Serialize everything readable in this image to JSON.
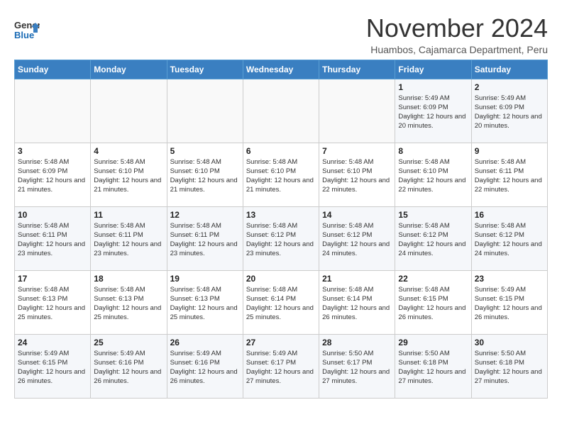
{
  "logo": {
    "line1": "General",
    "line2": "Blue"
  },
  "title": "November 2024",
  "subtitle": "Huambos, Cajamarca Department, Peru",
  "days_of_week": [
    "Sunday",
    "Monday",
    "Tuesday",
    "Wednesday",
    "Thursday",
    "Friday",
    "Saturday"
  ],
  "weeks": [
    [
      {
        "day": "",
        "info": ""
      },
      {
        "day": "",
        "info": ""
      },
      {
        "day": "",
        "info": ""
      },
      {
        "day": "",
        "info": ""
      },
      {
        "day": "",
        "info": ""
      },
      {
        "day": "1",
        "info": "Sunrise: 5:49 AM\nSunset: 6:09 PM\nDaylight: 12 hours and 20 minutes."
      },
      {
        "day": "2",
        "info": "Sunrise: 5:49 AM\nSunset: 6:09 PM\nDaylight: 12 hours and 20 minutes."
      }
    ],
    [
      {
        "day": "3",
        "info": "Sunrise: 5:48 AM\nSunset: 6:09 PM\nDaylight: 12 hours and 21 minutes."
      },
      {
        "day": "4",
        "info": "Sunrise: 5:48 AM\nSunset: 6:10 PM\nDaylight: 12 hours and 21 minutes."
      },
      {
        "day": "5",
        "info": "Sunrise: 5:48 AM\nSunset: 6:10 PM\nDaylight: 12 hours and 21 minutes."
      },
      {
        "day": "6",
        "info": "Sunrise: 5:48 AM\nSunset: 6:10 PM\nDaylight: 12 hours and 21 minutes."
      },
      {
        "day": "7",
        "info": "Sunrise: 5:48 AM\nSunset: 6:10 PM\nDaylight: 12 hours and 22 minutes."
      },
      {
        "day": "8",
        "info": "Sunrise: 5:48 AM\nSunset: 6:10 PM\nDaylight: 12 hours and 22 minutes."
      },
      {
        "day": "9",
        "info": "Sunrise: 5:48 AM\nSunset: 6:11 PM\nDaylight: 12 hours and 22 minutes."
      }
    ],
    [
      {
        "day": "10",
        "info": "Sunrise: 5:48 AM\nSunset: 6:11 PM\nDaylight: 12 hours and 23 minutes."
      },
      {
        "day": "11",
        "info": "Sunrise: 5:48 AM\nSunset: 6:11 PM\nDaylight: 12 hours and 23 minutes."
      },
      {
        "day": "12",
        "info": "Sunrise: 5:48 AM\nSunset: 6:11 PM\nDaylight: 12 hours and 23 minutes."
      },
      {
        "day": "13",
        "info": "Sunrise: 5:48 AM\nSunset: 6:12 PM\nDaylight: 12 hours and 23 minutes."
      },
      {
        "day": "14",
        "info": "Sunrise: 5:48 AM\nSunset: 6:12 PM\nDaylight: 12 hours and 24 minutes."
      },
      {
        "day": "15",
        "info": "Sunrise: 5:48 AM\nSunset: 6:12 PM\nDaylight: 12 hours and 24 minutes."
      },
      {
        "day": "16",
        "info": "Sunrise: 5:48 AM\nSunset: 6:12 PM\nDaylight: 12 hours and 24 minutes."
      }
    ],
    [
      {
        "day": "17",
        "info": "Sunrise: 5:48 AM\nSunset: 6:13 PM\nDaylight: 12 hours and 25 minutes."
      },
      {
        "day": "18",
        "info": "Sunrise: 5:48 AM\nSunset: 6:13 PM\nDaylight: 12 hours and 25 minutes."
      },
      {
        "day": "19",
        "info": "Sunrise: 5:48 AM\nSunset: 6:13 PM\nDaylight: 12 hours and 25 minutes."
      },
      {
        "day": "20",
        "info": "Sunrise: 5:48 AM\nSunset: 6:14 PM\nDaylight: 12 hours and 25 minutes."
      },
      {
        "day": "21",
        "info": "Sunrise: 5:48 AM\nSunset: 6:14 PM\nDaylight: 12 hours and 26 minutes."
      },
      {
        "day": "22",
        "info": "Sunrise: 5:48 AM\nSunset: 6:15 PM\nDaylight: 12 hours and 26 minutes."
      },
      {
        "day": "23",
        "info": "Sunrise: 5:49 AM\nSunset: 6:15 PM\nDaylight: 12 hours and 26 minutes."
      }
    ],
    [
      {
        "day": "24",
        "info": "Sunrise: 5:49 AM\nSunset: 6:15 PM\nDaylight: 12 hours and 26 minutes."
      },
      {
        "day": "25",
        "info": "Sunrise: 5:49 AM\nSunset: 6:16 PM\nDaylight: 12 hours and 26 minutes."
      },
      {
        "day": "26",
        "info": "Sunrise: 5:49 AM\nSunset: 6:16 PM\nDaylight: 12 hours and 26 minutes."
      },
      {
        "day": "27",
        "info": "Sunrise: 5:49 AM\nSunset: 6:17 PM\nDaylight: 12 hours and 27 minutes."
      },
      {
        "day": "28",
        "info": "Sunrise: 5:50 AM\nSunset: 6:17 PM\nDaylight: 12 hours and 27 minutes."
      },
      {
        "day": "29",
        "info": "Sunrise: 5:50 AM\nSunset: 6:18 PM\nDaylight: 12 hours and 27 minutes."
      },
      {
        "day": "30",
        "info": "Sunrise: 5:50 AM\nSunset: 6:18 PM\nDaylight: 12 hours and 27 minutes."
      }
    ]
  ]
}
